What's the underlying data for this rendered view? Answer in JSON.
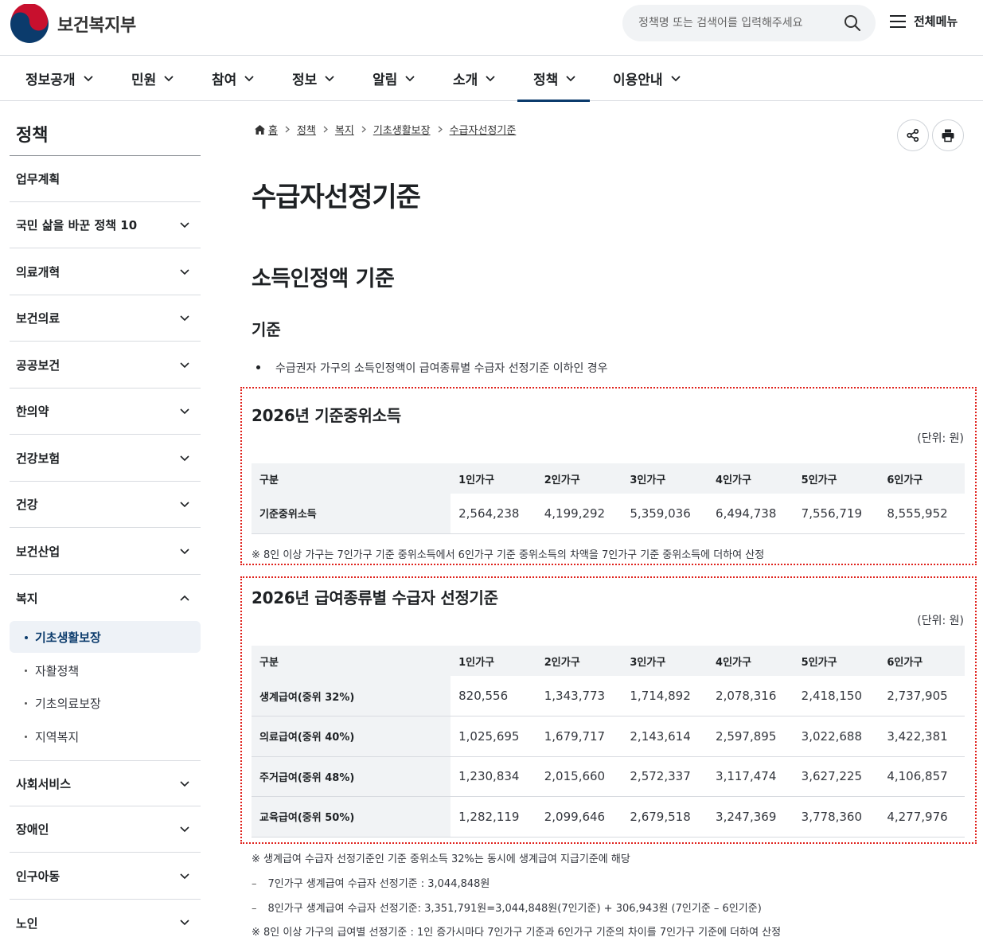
{
  "header": {
    "logo_text": "보건복지부",
    "search_placeholder": "정책명 또는 검색어를 입력해주세요",
    "all_menu_label": "전체메뉴"
  },
  "gnb": [
    "정보공개",
    "민원",
    "참여",
    "정보",
    "알림",
    "소개",
    "정책",
    "이용안내"
  ],
  "gnb_active": "정책",
  "sidebar": {
    "title": "정책",
    "items": [
      "업무계획",
      "국민 삶을 바꾼 정책 10",
      "의료개혁",
      "보건의료",
      "공공보건",
      "한의약",
      "건강보험",
      "건강",
      "보건산업",
      "복지"
    ],
    "sub_items": [
      "기초생활보장",
      "자활정책",
      "기초의료보장",
      "지역복지"
    ],
    "items_after": [
      "사회서비스",
      "장애인",
      "인구아동",
      "노인"
    ]
  },
  "breadcrumb": [
    "홈",
    "정책",
    "복지",
    "기초생활보장",
    "수급자선정기준"
  ],
  "page": {
    "title": "수급자선정기준",
    "section_title": "소득인정액 기준",
    "subsection_title": "기준",
    "bullet": "수급권자 가구의 소득인정액이 급여종류별 수급자 선정기준 이하인 경우"
  },
  "table1": {
    "title": "2026년 기준중위소득",
    "unit": "(단위: 원)",
    "headers": [
      "구분",
      "1인가구",
      "2인가구",
      "3인가구",
      "4인가구",
      "5인가구",
      "6인가구"
    ],
    "rows": [
      [
        "기준중위소득",
        "2,564,238",
        "4,199,292",
        "5,359,036",
        "6,494,738",
        "7,556,719",
        "8,555,952"
      ]
    ],
    "note": "※ 8인 이상 가구는 7인가구 기준 중위소득에서 6인가구 기준 중위소득의 차액을 7인가구 기준 중위소득에 더하여 산정"
  },
  "table2": {
    "title": "2026년 급여종류별 수급자 선정기준",
    "unit": "(단위: 원)",
    "headers": [
      "구분",
      "1인가구",
      "2인가구",
      "3인가구",
      "4인가구",
      "5인가구",
      "6인가구"
    ],
    "rows": [
      [
        "생계급여(중위 32%)",
        "820,556",
        "1,343,773",
        "1,714,892",
        "2,078,316",
        "2,418,150",
        "2,737,905"
      ],
      [
        "의료급여(중위 40%)",
        "1,025,695",
        "1,679,717",
        "2,143,614",
        "2,597,895",
        "3,022,688",
        "3,422,381"
      ],
      [
        "주거급여(중위 48%)",
        "1,230,834",
        "2,015,660",
        "2,572,337",
        "3,117,474",
        "3,627,225",
        "4,106,857"
      ],
      [
        "교육급여(중위 50%)",
        "1,282,119",
        "2,099,646",
        "2,679,518",
        "3,247,369",
        "3,778,360",
        "4,277,976"
      ]
    ],
    "notes": [
      "※ 생계급여 수급자 선정기준인 기준 중위소득 32%는 동시에 생계급여 지급기준에 해당",
      "7인가구 생계급여 수급자 선정기준 : 3,044,848원",
      "8인가구 생계급여 수급자 선정기준: 3,351,791원=3,044,848원(7인기준) + 306,943원 (7인기준 – 6인기준)",
      "※ 8인 이상 가구의 급여별 선정기준 : 1인 증가시마다 7인가구 기준과 6인가구 기준의 차이를 7인가구 기준에 더하여 산정"
    ]
  },
  "colors": {
    "brand_navy": "#0b3b6c",
    "highlight_border": "#e0221c",
    "table_header_bg": "#f1f3f5"
  }
}
